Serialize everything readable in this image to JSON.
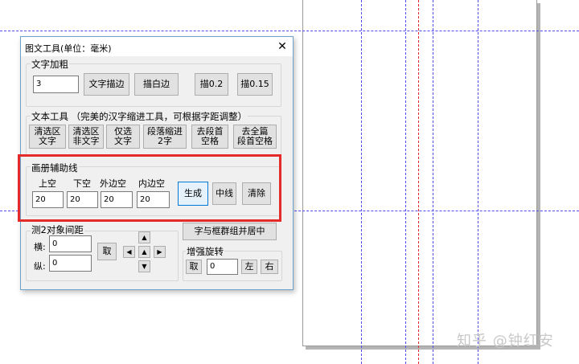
{
  "dialog": {
    "title": "图文工具(单位：毫米)",
    "close_glyph": "✕",
    "text_bold": {
      "label": "文字加粗",
      "value": "3",
      "stroke_button": "文字描边",
      "white_stroke_button": "描白边",
      "stroke_02_button": "描0.2",
      "stroke_015_button": "描0.15"
    },
    "text_tool": {
      "label": "文本工具 （完美的汉字缩进工具，可根据字距调整）",
      "buttons": [
        "清选区\n文字",
        "清选区\n非文字",
        "仅选\n文字",
        "段落缩进\n2字",
        "去段首\n空格",
        "去全篇\n段首空格"
      ]
    },
    "guides": {
      "label": "画册辅助线",
      "top_label": "上空",
      "bottom_label": "下空",
      "outer_label": "外边空",
      "inner_label": "内边空",
      "top_value": "20",
      "bottom_value": "20",
      "outer_value": "20",
      "inner_value": "20",
      "generate_button": "生成",
      "center_button": "中线",
      "clear_button": "清除"
    },
    "measure": {
      "label": "测2对象间距",
      "horizontal_label": "横:",
      "vertical_label": "纵:",
      "horizontal_value": "0",
      "vertical_value": "0",
      "take_button": "取",
      "arrows": [
        "▲",
        "◀",
        "▲",
        "▶",
        "▼"
      ]
    },
    "group_center_button": "字与框群组并居中",
    "rotate": {
      "label": "增强旋转",
      "take_button": "取",
      "value": "0",
      "left_button": "左",
      "right_button": "右"
    }
  },
  "watermark": "知乎 @钟红安",
  "colors": {
    "guide_blue": "#4d4df2",
    "guide_red": "#e02a2a",
    "highlight": "#e52a2a"
  }
}
